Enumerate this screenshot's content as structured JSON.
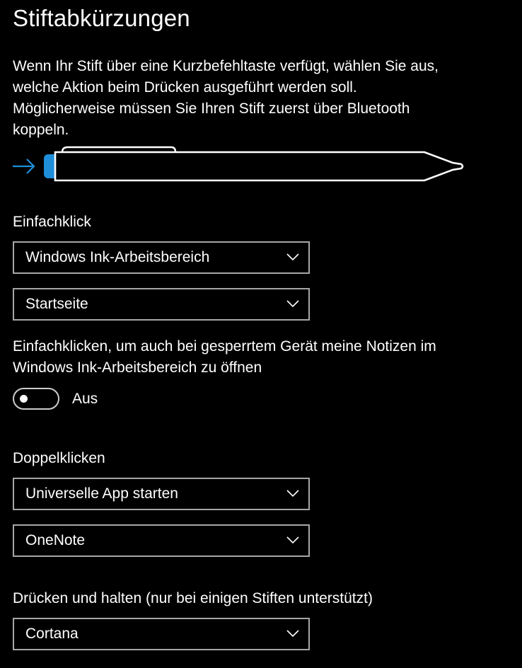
{
  "page": {
    "title": "Stiftabkürzungen",
    "description_lines": [
      "Wenn Ihr Stift über eine Kurzbefehltaste verfügt, wählen Sie aus,",
      "welche Aktion beim Drücken ausgeführt werden soll.",
      "Möglicherweise müssen Sie Ihren Stift zuerst über Bluetooth",
      "koppeln."
    ]
  },
  "pen_illustration": {
    "arrow_icon": "arrow-right-icon",
    "accent_color": "#1e8fd8"
  },
  "single_click": {
    "label": "Einfachklick",
    "action_value": "Windows Ink-Arbeitsbereich",
    "target_value": "Startseite"
  },
  "lock_toggle": {
    "description_lines": [
      "Einfachklicken, um auch bei gesperrtem Gerät meine Notizen im",
      "Windows Ink-Arbeitsbereich zu öffnen"
    ],
    "state_label": "Aus",
    "is_on": false
  },
  "double_click": {
    "label": "Doppelklicken",
    "action_value": "Universelle App starten",
    "target_value": "OneNote"
  },
  "press_hold": {
    "label": "Drücken und halten (nur bei einigen Stiften unterstützt)",
    "action_value": "Cortana"
  },
  "icons": {
    "dropdown_chevron": "chevron-down-icon"
  },
  "colors": {
    "background": "#000000",
    "text": "#ffffff",
    "control_border": "#a6a6a6",
    "accent": "#1e8fd8"
  }
}
